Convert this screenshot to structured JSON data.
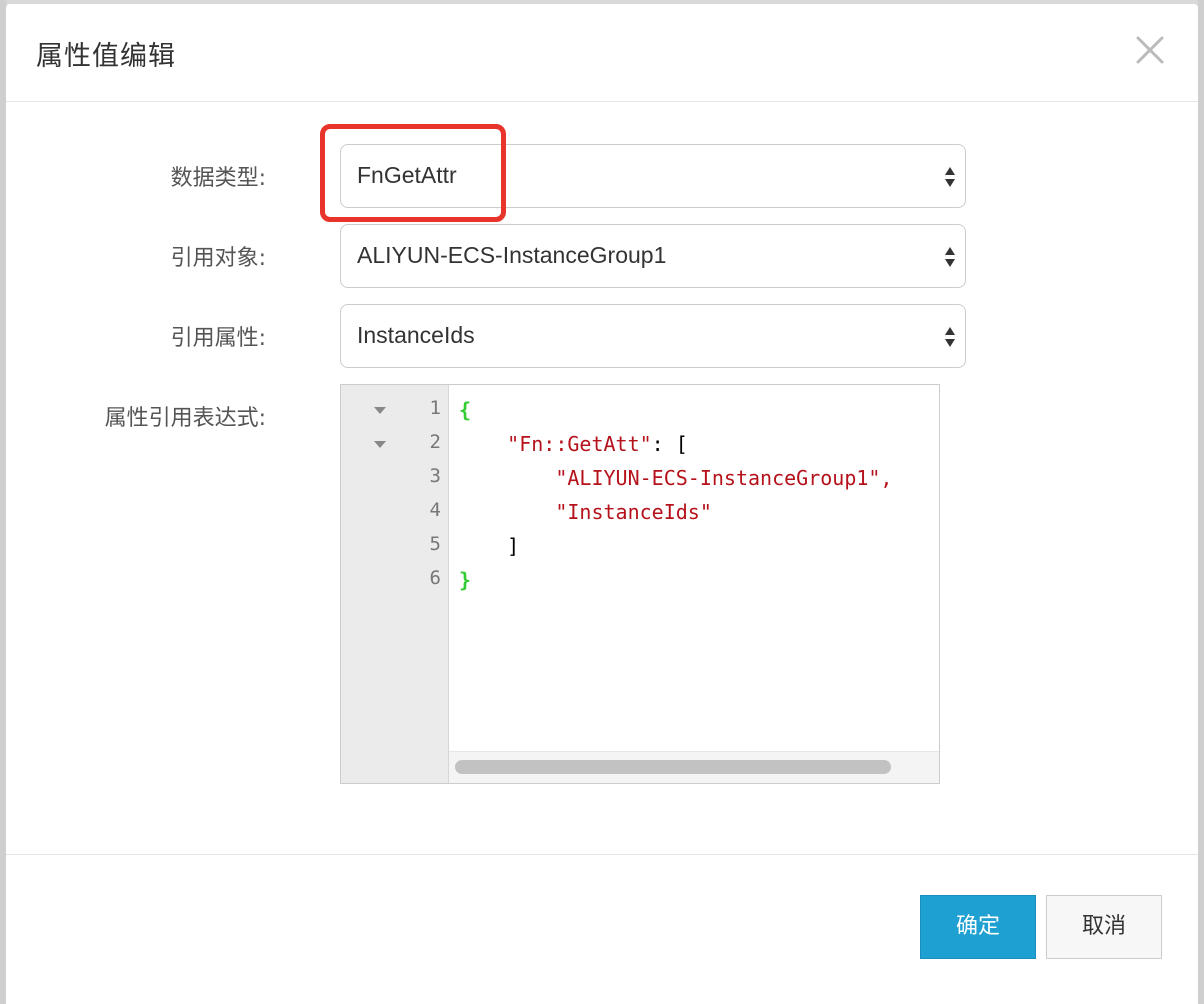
{
  "dialog": {
    "title": "属性值编辑",
    "close_icon": "close-icon"
  },
  "form": {
    "data_type": {
      "label": "数据类型:",
      "value": "FnGetAttr"
    },
    "ref_object": {
      "label": "引用对象:",
      "value": "ALIYUN-ECS-InstanceGroup1"
    },
    "ref_attribute": {
      "label": "引用属性:",
      "value": "InstanceIds"
    },
    "expression": {
      "label": "属性引用表达式:"
    }
  },
  "editor": {
    "lines": [
      {
        "num": "1",
        "fold": true,
        "indent": "",
        "tokens": [
          {
            "t": "{",
            "k": "brace"
          }
        ]
      },
      {
        "num": "2",
        "fold": true,
        "indent": "    ",
        "tokens": [
          {
            "t": "\"Fn::GetAtt\"",
            "k": "string"
          },
          {
            "t": ": [",
            "k": "plain"
          }
        ]
      },
      {
        "num": "3",
        "fold": false,
        "indent": "        ",
        "tokens": [
          {
            "t": "\"ALIYUN-ECS-InstanceGroup1\",",
            "k": "string"
          }
        ]
      },
      {
        "num": "4",
        "fold": false,
        "indent": "        ",
        "tokens": [
          {
            "t": "\"InstanceIds\"",
            "k": "string"
          }
        ]
      },
      {
        "num": "5",
        "fold": false,
        "indent": "    ",
        "tokens": [
          {
            "t": "]",
            "k": "plain"
          }
        ]
      },
      {
        "num": "6",
        "fold": false,
        "indent": "",
        "tokens": [
          {
            "t": "}",
            "k": "brace"
          }
        ]
      }
    ]
  },
  "footer": {
    "confirm_label": "确定",
    "cancel_label": "取消"
  },
  "colors": {
    "primary": "#1fa0d2",
    "highlight": "#e8342a",
    "json_brace": "#33cc33",
    "json_string": "#b5121b"
  }
}
